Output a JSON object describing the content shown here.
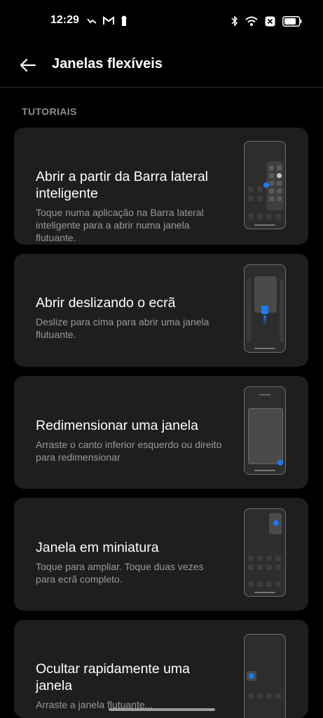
{
  "status_bar": {
    "time": "12:29",
    "left_icons": [
      "missed-call-icon",
      "gmail-icon",
      "keyhole-icon"
    ],
    "right_icons": [
      "bluetooth-icon",
      "wifi-icon",
      "no-sim-icon",
      "battery-icon"
    ]
  },
  "header": {
    "back_icon": "back-arrow-icon",
    "title": "Janelas flexíveis"
  },
  "section": {
    "title": "TUTORIAIS"
  },
  "cards": [
    {
      "title": "Abrir a partir da Barra lateral inteligente",
      "description": "Toque numa aplicação na Barra lateral inteligente para a abrir numa janela flutuante."
    },
    {
      "title": "Abrir deslizando o ecrã",
      "description": "Deslize para cima para abrir uma janela flutuante."
    },
    {
      "title": "Redimensionar uma janela",
      "description": "Arraste o canto inferior esquerdo ou direito para redimensionar"
    },
    {
      "title": "Janela em miniatura",
      "description": "Toque para ampliar. Toque duas vezes para ecrã completo."
    },
    {
      "title": "Ocultar rapidamente uma janela",
      "description": "Arraste a janela flutuante..."
    }
  ],
  "colors": {
    "background": "#000000",
    "card": "#1e1e1e",
    "accent": "#1a7af2",
    "section_header": "#8f8f8f"
  }
}
